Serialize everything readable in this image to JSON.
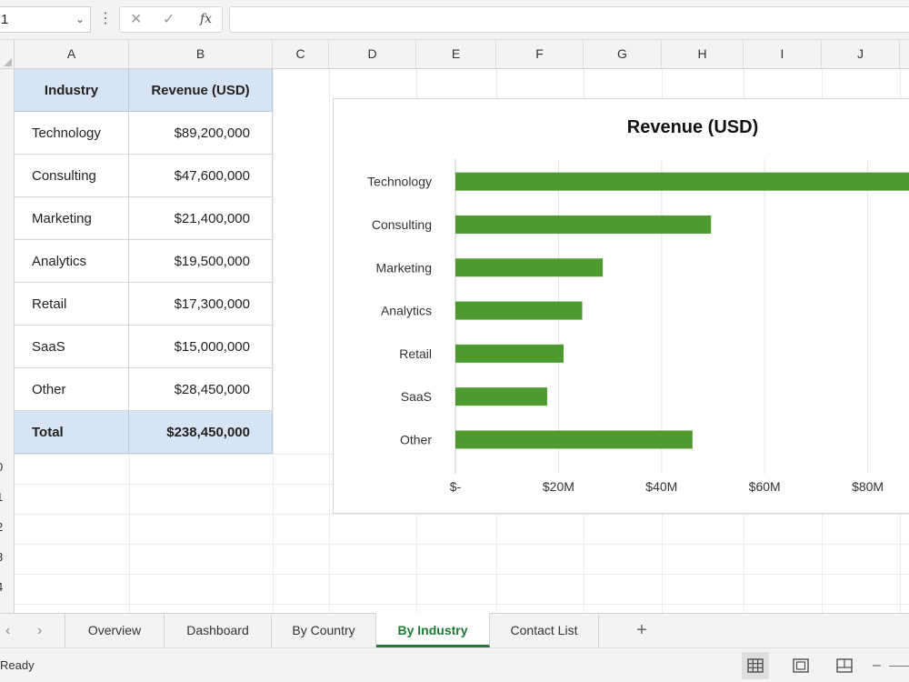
{
  "formula_bar": {
    "name_box": "1",
    "more_icon": "⋮",
    "cancel_icon": "✕",
    "enter_icon": "✓",
    "fx_label": "fx",
    "formula": ""
  },
  "columns": [
    "A",
    "B",
    "C",
    "D",
    "E",
    "F",
    "G",
    "H",
    "I",
    "J"
  ],
  "row_labels": [
    "0",
    "1",
    "2",
    "3",
    "4"
  ],
  "table": {
    "header": {
      "industry": "Industry",
      "revenue": "Revenue (USD)"
    },
    "rows": [
      {
        "industry": "Technology",
        "revenue": "$89,200,000"
      },
      {
        "industry": "Consulting",
        "revenue": "$47,600,000"
      },
      {
        "industry": "Marketing",
        "revenue": "$21,400,000"
      },
      {
        "industry": "Analytics",
        "revenue": "$19,500,000"
      },
      {
        "industry": "Retail",
        "revenue": "$17,300,000"
      },
      {
        "industry": "SaaS",
        "revenue": "$15,000,000"
      },
      {
        "industry": "Other",
        "revenue": "$28,450,000"
      }
    ],
    "total": {
      "label": "Total",
      "revenue": "$238,450,000"
    }
  },
  "chart_data": {
    "type": "bar",
    "orientation": "horizontal",
    "title": "Revenue (USD)",
    "categories": [
      "Technology",
      "Consulting",
      "Marketing",
      "Analytics",
      "Retail",
      "SaaS",
      "Other"
    ],
    "values": [
      89.2,
      49.6,
      28.6,
      24.6,
      21.0,
      17.8,
      46.0
    ],
    "x_unit": "M USD",
    "xlim": [
      0,
      90
    ],
    "x_ticks": [
      0,
      20,
      40,
      60,
      80
    ],
    "x_tick_labels": [
      "$-",
      "$20M",
      "$40M",
      "$60M",
      "$80M"
    ],
    "grid": true,
    "legend": "none",
    "bar_color": "#4e9a2e"
  },
  "sheet_tabs": {
    "prev_icon": "‹",
    "next_icon": "›",
    "tabs": [
      {
        "label": "Overview",
        "active": false
      },
      {
        "label": "Dashboard",
        "active": false
      },
      {
        "label": "By Country",
        "active": false
      },
      {
        "label": "By Industry",
        "active": true
      },
      {
        "label": "Contact List",
        "active": false
      }
    ],
    "add_icon": "+"
  },
  "status_bar": {
    "status": "Ready",
    "active_view": "normal",
    "zoom_minus": "–"
  },
  "colors": {
    "accent": "#1e7a34",
    "header_fill": "#d7e4f3",
    "bar": "#4e9a2e"
  }
}
